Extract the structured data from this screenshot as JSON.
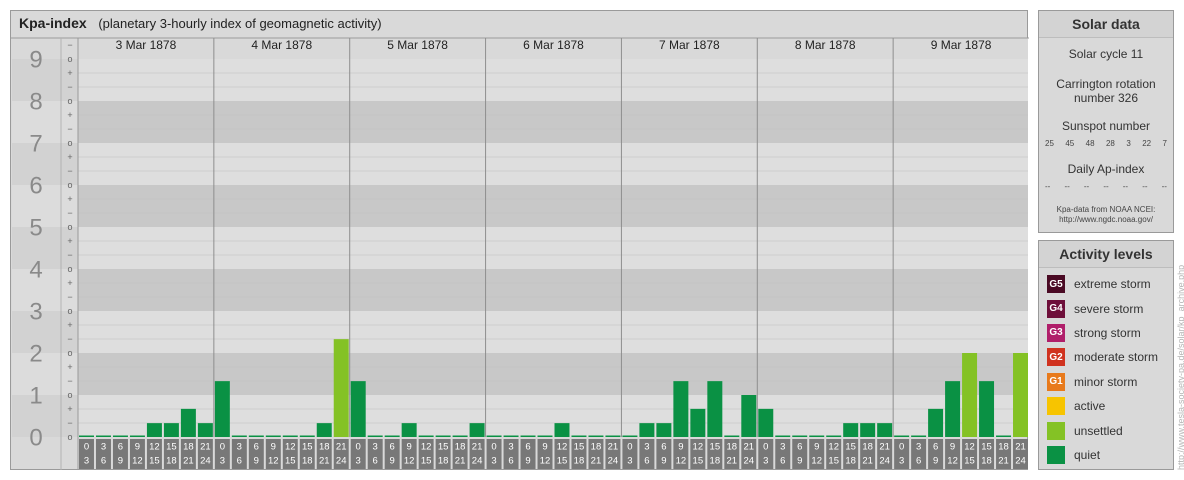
{
  "title": {
    "name": "Kpa-index",
    "subtitle": "(planetary 3-hourly index of geomagnetic activity)"
  },
  "chart_data": {
    "type": "bar",
    "title": "Kpa-index",
    "subtitle": "(planetary 3-hourly index of geomagnetic activity)",
    "ylim": [
      0,
      9
    ],
    "y_ticks": [
      "0",
      "1",
      "2",
      "3",
      "4",
      "5",
      "6",
      "7",
      "8",
      "9"
    ],
    "minor_tick_labels": [
      "+",
      "o",
      "−"
    ],
    "days": [
      "3 Mar 1878",
      "4 Mar 1878",
      "5 Mar 1878",
      "6 Mar 1878",
      "7 Mar 1878",
      "8 Mar 1878",
      "9 Mar 1878"
    ],
    "interval_starts": [
      "0",
      "3",
      "6",
      "9",
      "12",
      "15",
      "18",
      "21"
    ],
    "interval_ends": [
      "3",
      "6",
      "9",
      "12",
      "15",
      "18",
      "21",
      "24"
    ],
    "values": [
      [
        0,
        0,
        0,
        0,
        0.33,
        0.33,
        0.67,
        0.33
      ],
      [
        1.33,
        0,
        0,
        0,
        0,
        0,
        0.33,
        2.33
      ],
      [
        1.33,
        0,
        0,
        0.33,
        0,
        0,
        0,
        0.33
      ],
      [
        0,
        0,
        0,
        0,
        0.33,
        0,
        0,
        0
      ],
      [
        0,
        0.33,
        0.33,
        1.33,
        0.67,
        1.33,
        0,
        1
      ],
      [
        0.67,
        0,
        0,
        0,
        0,
        0.33,
        0.33,
        0.33
      ],
      [
        0,
        0,
        0.67,
        1.33,
        2,
        1.33,
        0,
        2
      ]
    ],
    "grid": true
  },
  "solar_data": {
    "heading": "Solar data",
    "solar_cycle": "Solar cycle 11",
    "carrington_line1": "Carrington rotation",
    "carrington_line2": "number 326",
    "sunspot_heading": "Sunspot number",
    "sunspot_values": [
      "25",
      "45",
      "48",
      "28",
      "3",
      "22",
      "7"
    ],
    "ap_heading": "Daily Ap-index",
    "ap_values": [
      "--",
      "--",
      "--",
      "--",
      "--",
      "--",
      "--"
    ],
    "source_line1": "Kpa-data from NOAA NCEI:",
    "source_line2": "http://www.ngdc.noaa.gov/"
  },
  "activity_levels": {
    "heading": "Activity levels",
    "items": [
      {
        "code": "G5",
        "label": "extreme storm",
        "color": "#4a0a24"
      },
      {
        "code": "G4",
        "label": "severe storm",
        "color": "#6e0f3a"
      },
      {
        "code": "G3",
        "label": "strong storm",
        "color": "#b01e6a"
      },
      {
        "code": "G2",
        "label": "moderate storm",
        "color": "#d0321f"
      },
      {
        "code": "G1",
        "label": "minor storm",
        "color": "#e87a1c"
      },
      {
        "code": "",
        "label": "active",
        "color": "#f7c400"
      },
      {
        "code": "",
        "label": "unsettled",
        "color": "#84c225"
      },
      {
        "code": "",
        "label": "quiet",
        "color": "#0a9144"
      }
    ]
  },
  "watermark": "http://www.tesla-society-pa.de/solar/kp_archive.php"
}
